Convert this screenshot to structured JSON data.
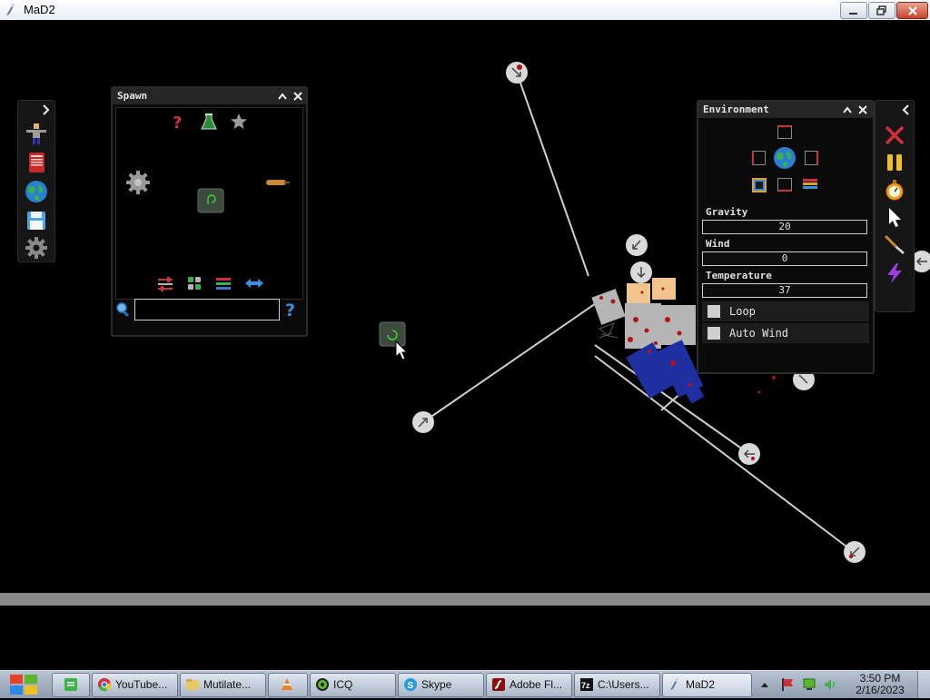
{
  "window": {
    "title": "MaD2",
    "controls": [
      "minimize",
      "maximize",
      "close"
    ]
  },
  "spawn_panel": {
    "title": "Spawn",
    "search": {
      "value": "",
      "placeholder": ""
    },
    "help_glyph": "?",
    "category_icons": [
      "question-icon",
      "flask-icon",
      "star-icon"
    ],
    "bottom_icons": [
      "sliders-icon",
      "grid-icon",
      "list-icon",
      "arrows-icon"
    ],
    "items": [
      "gear-item",
      "roller-item",
      "green-box-item"
    ]
  },
  "environment_panel": {
    "title": "Environment",
    "fields": [
      {
        "label": "Gravity",
        "value": "20"
      },
      {
        "label": "Wind",
        "value": "0"
      },
      {
        "label": "Temperature",
        "value": "37"
      }
    ],
    "checkboxes": [
      {
        "label": "Loop",
        "checked": false
      },
      {
        "label": "Auto Wind",
        "checked": false
      }
    ]
  },
  "left_toolbar": [
    "ragdoll-icon",
    "book-icon",
    "globe-icon",
    "save-icon",
    "gear-icon"
  ],
  "right_toolbar": [
    "close-x-icon",
    "pause-icon",
    "stopwatch-icon",
    "pointer-icon",
    "knife-icon",
    "lightning-icon"
  ],
  "colors": {
    "background": "#000000",
    "ground": "#8a8a8a",
    "blood": "#b0141a",
    "ragdoll_blue": "#1f2fa0",
    "ragdoll_skin": "#f0c48c"
  },
  "taskbar": {
    "items": [
      {
        "label": "",
        "icon": "green-app-icon"
      },
      {
        "label": "YouTube...",
        "icon": "chrome-icon"
      },
      {
        "label": "Mutilate...",
        "icon": "folder-icon"
      },
      {
        "label": "",
        "icon": "vlc-icon"
      },
      {
        "label": "ICQ",
        "icon": "icq-icon"
      },
      {
        "label": "Skype",
        "icon": "skype-icon"
      },
      {
        "label": "Adobe Fl...",
        "icon": "flash-icon"
      },
      {
        "label": "C:\\Users...",
        "icon": "7zip-icon"
      },
      {
        "label": "MaD2",
        "icon": "mad2-icon"
      }
    ],
    "clock": {
      "time": "3:50 PM",
      "date": "2/16/2023"
    }
  }
}
